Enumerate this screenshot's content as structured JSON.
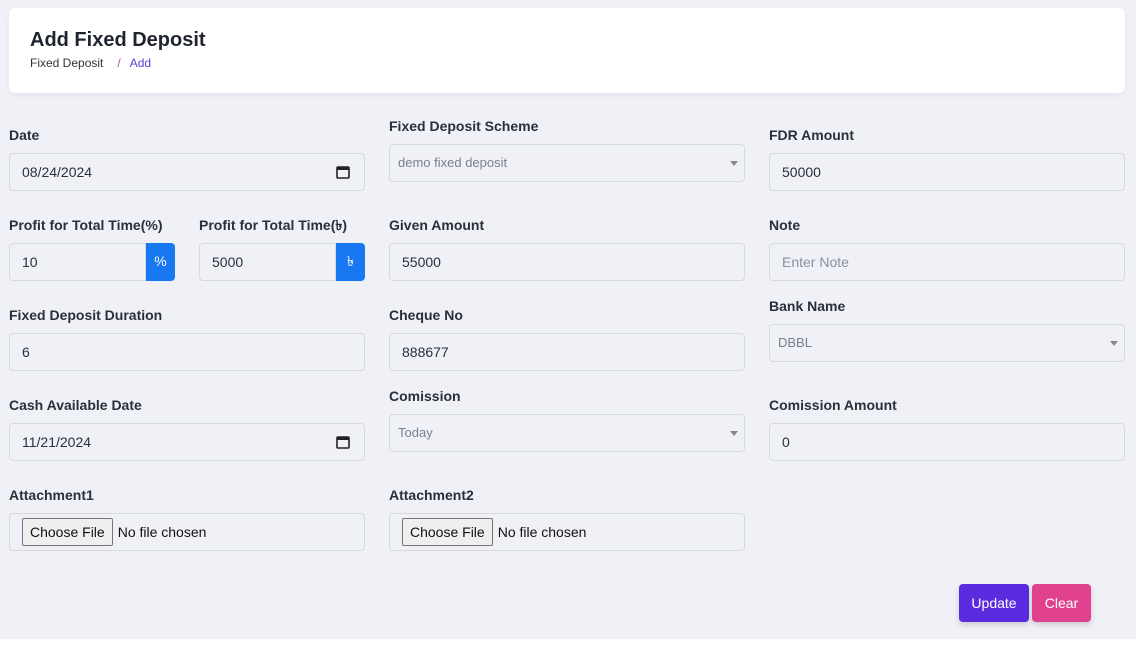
{
  "header": {
    "title": "Add Fixed Deposit",
    "breadcrumb": [
      "Fixed Deposit",
      "/",
      "Add"
    ]
  },
  "form": {
    "date": {
      "label": "Date",
      "value": "08/24/2024"
    },
    "scheme": {
      "label": "Fixed Deposit Scheme",
      "value": "demo fixed deposit"
    },
    "fdr_amount": {
      "label": "FDR Amount",
      "value": "50000"
    },
    "profit_percent": {
      "label": "Profit for Total Time(%)",
      "value": "10",
      "addon": "%"
    },
    "profit_taka": {
      "label": "Profit for Total Time(৳)",
      "value": "5000",
      "addon": "৳"
    },
    "given_amount": {
      "label": "Given Amount",
      "value": "55000"
    },
    "note": {
      "label": "Note",
      "placeholder": "Enter Note",
      "value": ""
    },
    "duration": {
      "label": "Fixed Deposit Duration",
      "value": "6"
    },
    "cheque_no": {
      "label": "Cheque No",
      "value": "888677"
    },
    "bank_name": {
      "label": "Bank Name",
      "value": "DBBL"
    },
    "cash_available_date": {
      "label": "Cash Available Date",
      "value": "11/21/2024"
    },
    "commission": {
      "label": "Comission",
      "value": "Today"
    },
    "commission_amount": {
      "label": "Comission Amount",
      "value": "0"
    },
    "attachment1": {
      "label": "Attachment1",
      "button": "Choose File",
      "status": "No file chosen"
    },
    "attachment2": {
      "label": "Attachment2",
      "button": "Choose File",
      "status": "No file chosen"
    }
  },
  "actions": {
    "update": "Update",
    "clear": "Clear"
  },
  "colors": {
    "background": "#f0f1f7",
    "addon_blue": "#1778f2",
    "update_button": "#5b2be0",
    "clear_button": "#e0428f"
  }
}
